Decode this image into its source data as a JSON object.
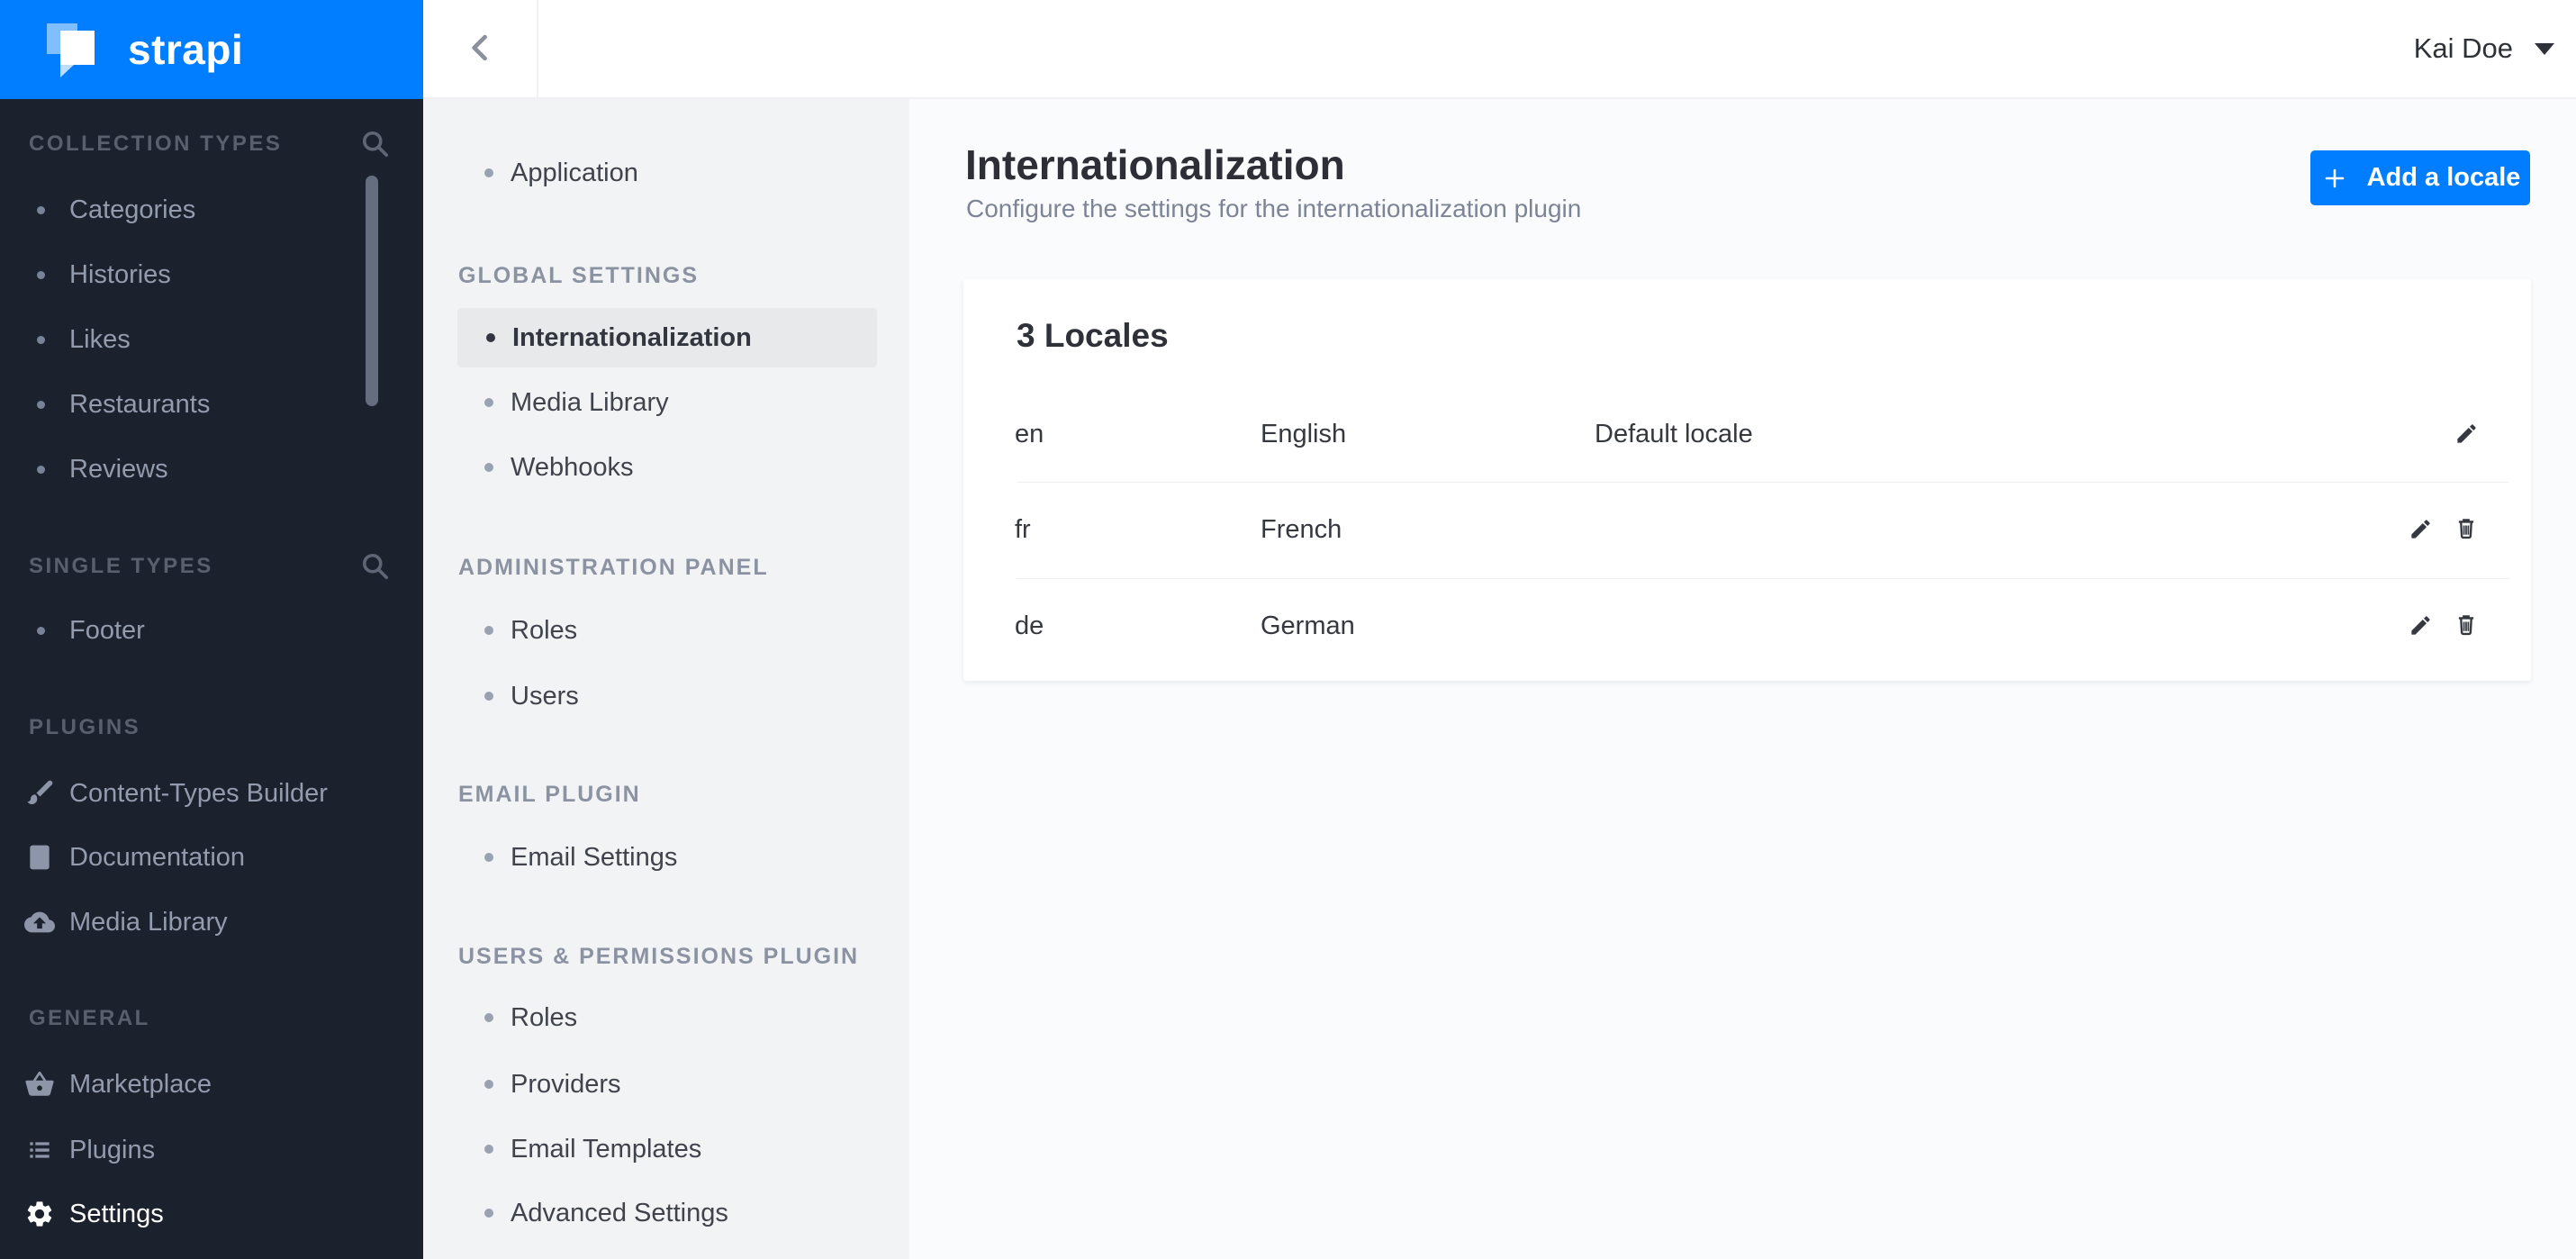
{
  "brand": {
    "name": "strapi",
    "accent_color": "#007eff"
  },
  "topbar": {
    "user_name": "Kai Doe",
    "back_icon": "chevron-left-icon",
    "user_caret_icon": "chevron-down-icon"
  },
  "sidebar": {
    "background_color": "#1c222d",
    "sections": [
      {
        "label": "COLLECTION TYPES",
        "search_icon": "search-icon",
        "items": [
          {
            "label": "Categories"
          },
          {
            "label": "Histories"
          },
          {
            "label": "Likes"
          },
          {
            "label": "Restaurants"
          },
          {
            "label": "Reviews"
          }
        ]
      },
      {
        "label": "SINGLE TYPES",
        "search_icon": "search-icon",
        "items": [
          {
            "label": "Footer"
          }
        ]
      },
      {
        "label": "PLUGINS",
        "items": [
          {
            "label": "Content-Types Builder",
            "icon": "paintbrush-icon"
          },
          {
            "label": "Documentation",
            "icon": "book-icon"
          },
          {
            "label": "Media Library",
            "icon": "cloud-upload-icon"
          }
        ]
      },
      {
        "label": "GENERAL",
        "items": [
          {
            "label": "Marketplace",
            "icon": "basket-icon"
          },
          {
            "label": "Plugins",
            "icon": "list-icon"
          },
          {
            "label": "Settings",
            "icon": "gear-icon",
            "active": true
          }
        ]
      }
    ]
  },
  "settings_menu": {
    "standalone_items": [
      {
        "label": "Application"
      }
    ],
    "groups": [
      {
        "label": "GLOBAL SETTINGS",
        "items": [
          {
            "label": "Internationalization",
            "selected": true
          },
          {
            "label": "Media Library"
          },
          {
            "label": "Webhooks"
          }
        ]
      },
      {
        "label": "ADMINISTRATION PANEL",
        "items": [
          {
            "label": "Roles"
          },
          {
            "label": "Users"
          }
        ]
      },
      {
        "label": "EMAIL PLUGIN",
        "items": [
          {
            "label": "Email Settings"
          }
        ]
      },
      {
        "label": "USERS & PERMISSIONS PLUGIN",
        "items": [
          {
            "label": "Roles"
          },
          {
            "label": "Providers"
          },
          {
            "label": "Email Templates"
          },
          {
            "label": "Advanced Settings"
          }
        ]
      }
    ]
  },
  "page": {
    "title": "Internationalization",
    "subtitle": "Configure the settings for the internationalization plugin",
    "add_locale_button": "Add a locale",
    "add_icon": "plus-icon"
  },
  "locales_card": {
    "title": "3 Locales",
    "rows": [
      {
        "code": "en",
        "name": "English",
        "default_label": "Default locale",
        "actions": [
          "edit-pencil-icon"
        ]
      },
      {
        "code": "fr",
        "name": "French",
        "default_label": "",
        "actions": [
          "edit-pencil-icon",
          "delete-trash-icon"
        ]
      },
      {
        "code": "de",
        "name": "German",
        "default_label": "",
        "actions": [
          "edit-pencil-icon",
          "delete-trash-icon"
        ]
      }
    ]
  }
}
